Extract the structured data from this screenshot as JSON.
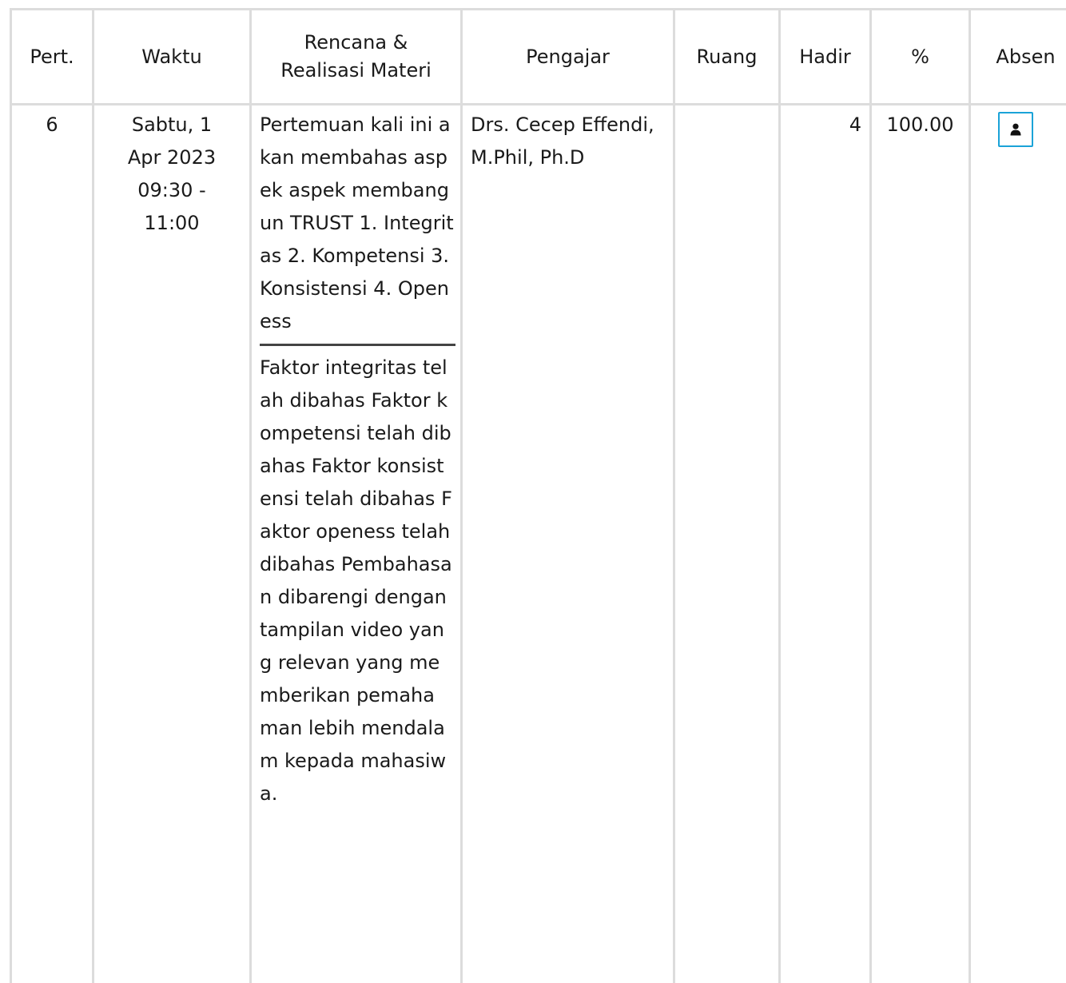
{
  "table": {
    "headers": {
      "pert": "Pert.",
      "waktu": "Waktu",
      "materi": "Rencana & Realisasi Materi",
      "pengajar": "Pengajar",
      "ruang": "Ruang",
      "hadir": "Hadir",
      "persen": "%",
      "absen": "Absen"
    },
    "rows": [
      {
        "pert": "6",
        "waktu_day": "Sabtu, 1",
        "waktu_date": "Apr 2023",
        "waktu_time": "09:30 -",
        "waktu_end": "11:00",
        "rencana": "Pertemuan kali ini akan membahas aspek aspek membangun TRUST 1. Integritas 2. Kompetensi 3. Konsistensi 4. Openess",
        "realisasi": "Faktor integritas telah dibahas Faktor kompetensi telah dibahas Faktor konsistensi telah dibahas Faktor openess telah dibahas Pembahasan dibarengi dengan tampilan video yang relevan yang memberikan pemahaman lebih mendalam kepada mahasiwa.",
        "pengajar": "Drs. Cecep Effendi, M.Phil, Ph.D",
        "ruang": "",
        "hadir": "4",
        "persen": "100.00",
        "absen_icon": "user-icon"
      }
    ]
  },
  "colors": {
    "border": "#dcdcdc",
    "divider": "#444444",
    "button_border": "#1aa3d8"
  }
}
